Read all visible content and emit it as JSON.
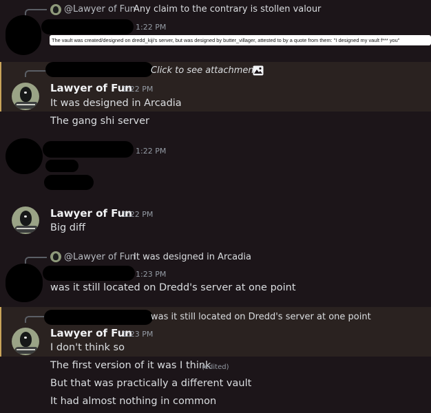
{
  "reply1": {
    "name": "@Lawyer of Fun",
    "text": "Any claim to the contrary is stollen valour"
  },
  "msg1": {
    "time": "1:22 PM",
    "tooltip": "The vault was created/designed on dredd_kiji's server, but was designed by butter_villager, attested to by a quote from them: \"I designed my vault f*** you\""
  },
  "reply2": {
    "text": "Click to see attachment",
    "icon": "image-icon"
  },
  "msg2": {
    "name": "Lawyer of Fun",
    "time": "1:22 PM",
    "lines": [
      "It was designed in Arcadia",
      "The gang shi server"
    ]
  },
  "msg3": {
    "time": "1:22 PM"
  },
  "msg4": {
    "name": "Lawyer of Fun",
    "time": "1:22 PM",
    "text": "Big diff"
  },
  "reply3": {
    "name": "@Lawyer of Fun",
    "text": "It was designed in Arcadia"
  },
  "msg5": {
    "time": "1:23 PM",
    "text": "was it still located on Dredd's server at one point"
  },
  "reply4": {
    "text": "was it still located on Dredd's server at one point"
  },
  "msg6": {
    "name": "Lawyer of Fun",
    "time": "1:23 PM",
    "lines": [
      "I don't think so",
      "The first version of it was I think",
      "But that was practically a different vault",
      "It had almost nothing in common"
    ],
    "edited": "(edited)"
  },
  "colors": {
    "background": "#1c1519",
    "highlight": "#2a2220",
    "mention_bar": "#c9a45a"
  }
}
